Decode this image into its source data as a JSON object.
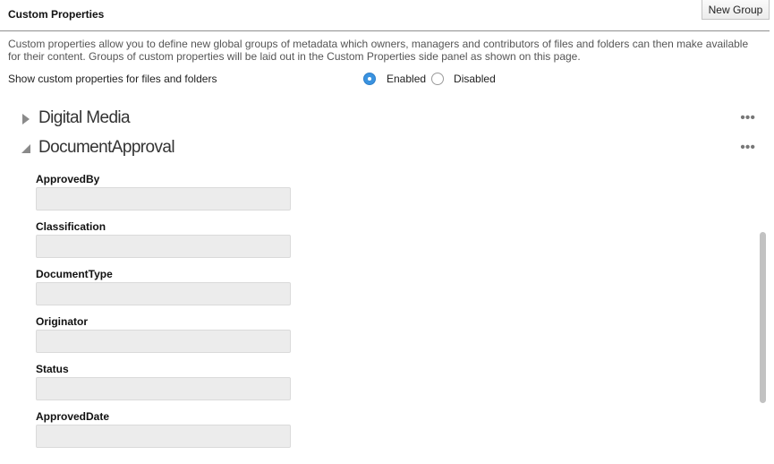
{
  "header": {
    "title": "Custom Properties",
    "new_group_label": "New Group"
  },
  "description": "Custom properties allow you to define new global groups of metadata which owners, managers and contributors of files and folders can then make available for their content. Groups of custom properties will be laid out in the Custom Properties side panel as shown on this page.",
  "visibility": {
    "label": "Show custom properties for files and folders",
    "options": [
      {
        "label": "Enabled",
        "selected": true
      },
      {
        "label": "Disabled",
        "selected": false
      }
    ]
  },
  "groups": [
    {
      "name": "Digital Media",
      "expanded": false,
      "menu_glyph": "•••"
    },
    {
      "name": "DocumentApproval",
      "expanded": true,
      "menu_glyph": "•••"
    }
  ],
  "fields": [
    {
      "label": "ApprovedBy",
      "value": ""
    },
    {
      "label": "Classification",
      "value": ""
    },
    {
      "label": "DocumentType",
      "value": ""
    },
    {
      "label": "Originator",
      "value": ""
    },
    {
      "label": "Status",
      "value": ""
    },
    {
      "label": "ApprovedDate",
      "value": ""
    }
  ],
  "colors": {
    "accent": "#3a93e0",
    "input_background": "#ececec"
  }
}
